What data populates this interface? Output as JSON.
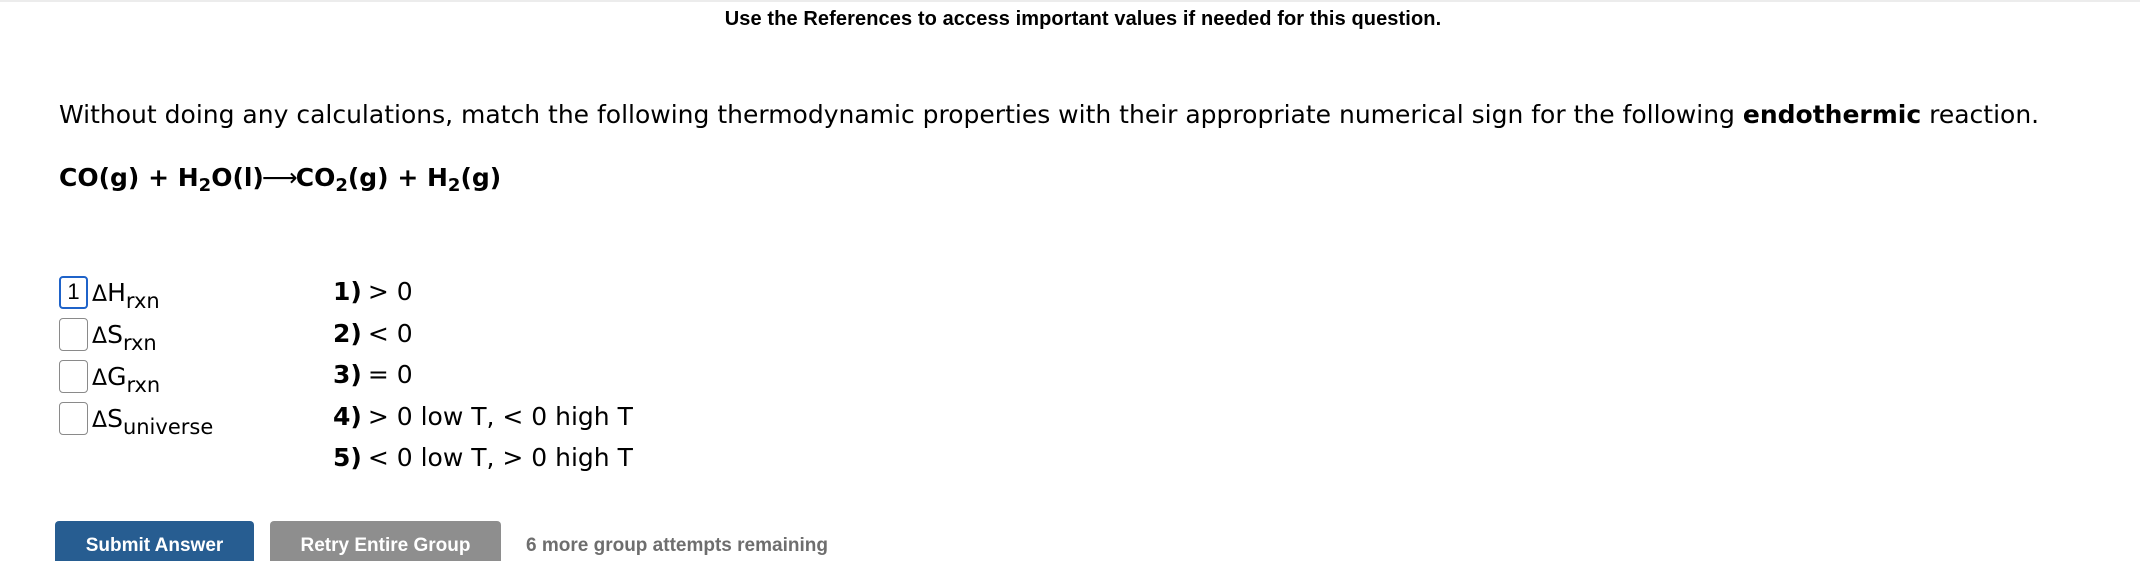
{
  "header": {
    "references_note": "Use the References to access important values if needed for this question."
  },
  "question": {
    "text_before": "Without doing any calculations, match the following thermodynamic properties with their appropriate numerical sign for the following ",
    "emphasis": "endothermic",
    "text_after": " reaction."
  },
  "reaction": {
    "reactant1": "CO(g)",
    "plus1": " + ",
    "reactant2_a": "H",
    "reactant2_sub": "2",
    "reactant2_b": "O(l)",
    "arrow": "⟶",
    "product1_a": "CO",
    "product1_sub": "2",
    "product1_b": "(g)",
    "plus2": " + ",
    "product2_a": "H",
    "product2_sub": "2",
    "product2_b": "(g)"
  },
  "properties": [
    {
      "delta": "Δ",
      "symbol": "H",
      "subscript": "rxn",
      "answer": "1",
      "focused": true
    },
    {
      "delta": "Δ",
      "symbol": "S",
      "subscript": "rxn",
      "answer": "",
      "focused": false
    },
    {
      "delta": "Δ",
      "symbol": "G",
      "subscript": "rxn",
      "answer": "",
      "focused": false
    },
    {
      "delta": "Δ",
      "symbol": "S",
      "subscript": "universe",
      "answer": "",
      "focused": false
    }
  ],
  "options": [
    {
      "num": "1)",
      "text": "> 0"
    },
    {
      "num": "2)",
      "text": "< 0"
    },
    {
      "num": "3)",
      "text": "= 0"
    },
    {
      "num": "4)",
      "text": "> 0 low T, < 0 high T"
    },
    {
      "num": "5)",
      "text": "< 0 low T, > 0 high T"
    }
  ],
  "buttons": {
    "submit_label": "Submit Answer",
    "retry_label": "Retry Entire Group"
  },
  "attempts_text": "6 more group attempts remaining",
  "colors": {
    "submit_bg": "#275d91",
    "retry_bg": "#8e8e8e",
    "focus_border": "#1f63c9",
    "attempts_text": "#6e6e6e"
  }
}
